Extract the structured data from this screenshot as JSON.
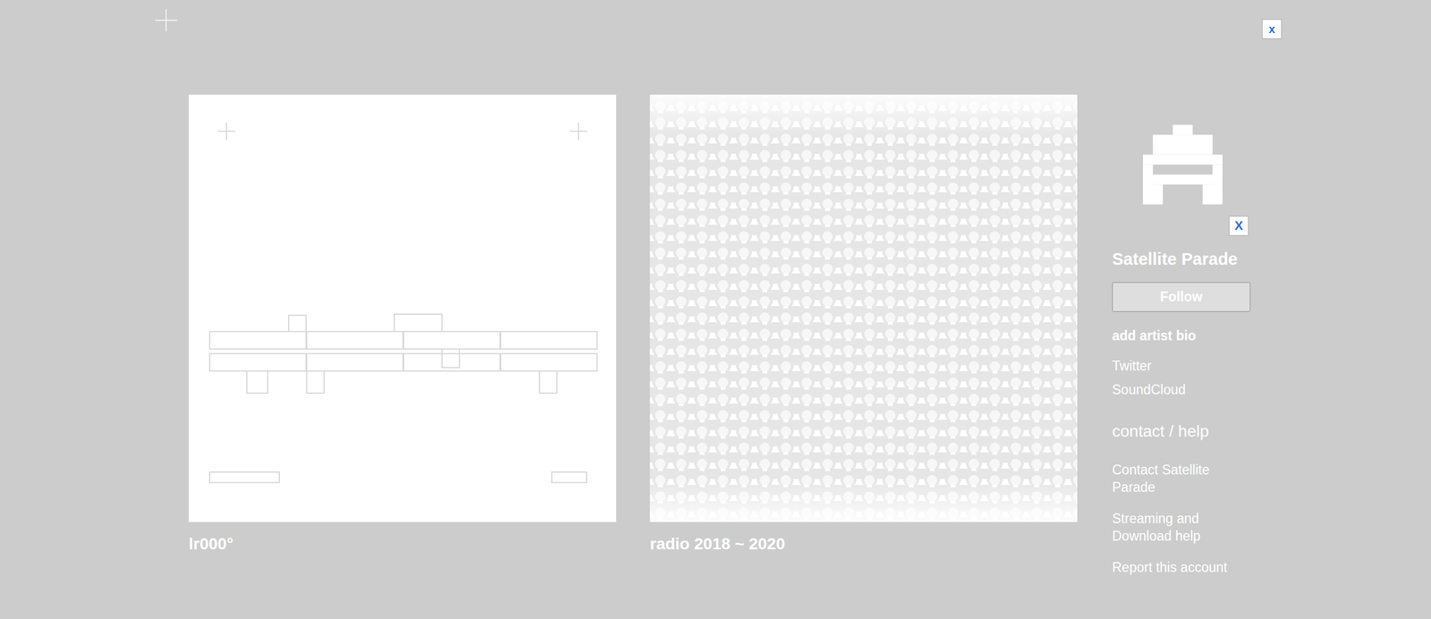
{
  "top_badge": "x",
  "albums": [
    {
      "title": "lr000°",
      "kind": "lines"
    },
    {
      "title": "radio 2018 ~ 2020",
      "kind": "pattern"
    }
  ],
  "artist": {
    "name": "Satellite Parade",
    "avatar_badge": "X",
    "follow_button": "Follow",
    "bio_link": "add artist bio",
    "links": [
      "Twitter",
      "SoundCloud"
    ]
  },
  "contact": {
    "heading": "contact / help",
    "links": [
      "Contact Satellite Parade",
      "Streaming and Download help",
      "Report this account"
    ]
  }
}
